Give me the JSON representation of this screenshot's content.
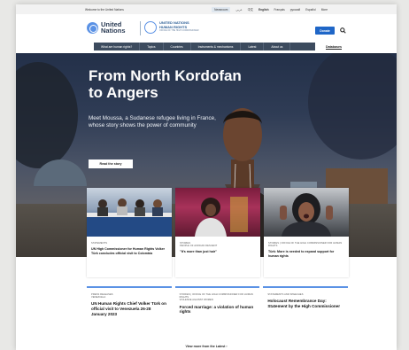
{
  "topbar": {
    "welcome": "Welcome to the United Nations",
    "languages": [
      "Newsroom",
      "عربي",
      "中文",
      "English",
      "Français",
      "русский",
      "Español",
      "More"
    ]
  },
  "header": {
    "un_line1": "United",
    "un_line2": "Nations",
    "ohchr_line1": "UNITED NATIONS",
    "ohchr_line2": "HUMAN RIGHTS",
    "ohchr_sub": "OFFICE OF THE HIGH COMMISSIONER",
    "donate_label": "Donate"
  },
  "nav": {
    "items": [
      "What are human rights?",
      "Topics",
      "Countries",
      "Instruments & mechanisms",
      "Latest",
      "About us"
    ],
    "underlined": "Databases"
  },
  "hero": {
    "title": "From North Kordofan to Angers",
    "description": "Meet Moussa, a Sudanese refugee living in France, whose story shows the power of community",
    "button_label": "Read the story"
  },
  "cards": [
    {
      "tag": "STATEMENTS",
      "title": "UN High Commissioner for Human Rights Volker Türk concludes official visit to Colombia"
    },
    {
      "tag": "STORIES\nPEOPLE OF AFRICAN DESCENT",
      "title": "\"It's more than just hair\""
    },
    {
      "tag": "STORIES | OFFICE OF THE HIGH COMMISSIONER FOR HUMAN RIGHTS",
      "title": "Türk: More is needed to expand support for human rights"
    }
  ],
  "cards2": [
    {
      "tag": "PRESS RELEASES\nVENEZUELA",
      "title": "UN Human Rights Chief Volker Türk on official visit to Venezuela 26-28 January 2023"
    },
    {
      "tag": "STORIES | OFFICE OF THE HIGH COMMISSIONER FOR HUMAN RIGHTS\nVIOLENCE AGAINST WOMEN",
      "title": "Forced marriage: a violation of human rights"
    },
    {
      "tag": "STATEMENTS AND SPEECHES",
      "title": "Holocaust Remembrance Day: Statement by the High Commissioner"
    }
  ],
  "more_link": "View more from the Latest ›",
  "colors": {
    "accent": "#1f66c7",
    "nav_bg": "#3c4b5e",
    "un_blue": "#5b92e5"
  }
}
